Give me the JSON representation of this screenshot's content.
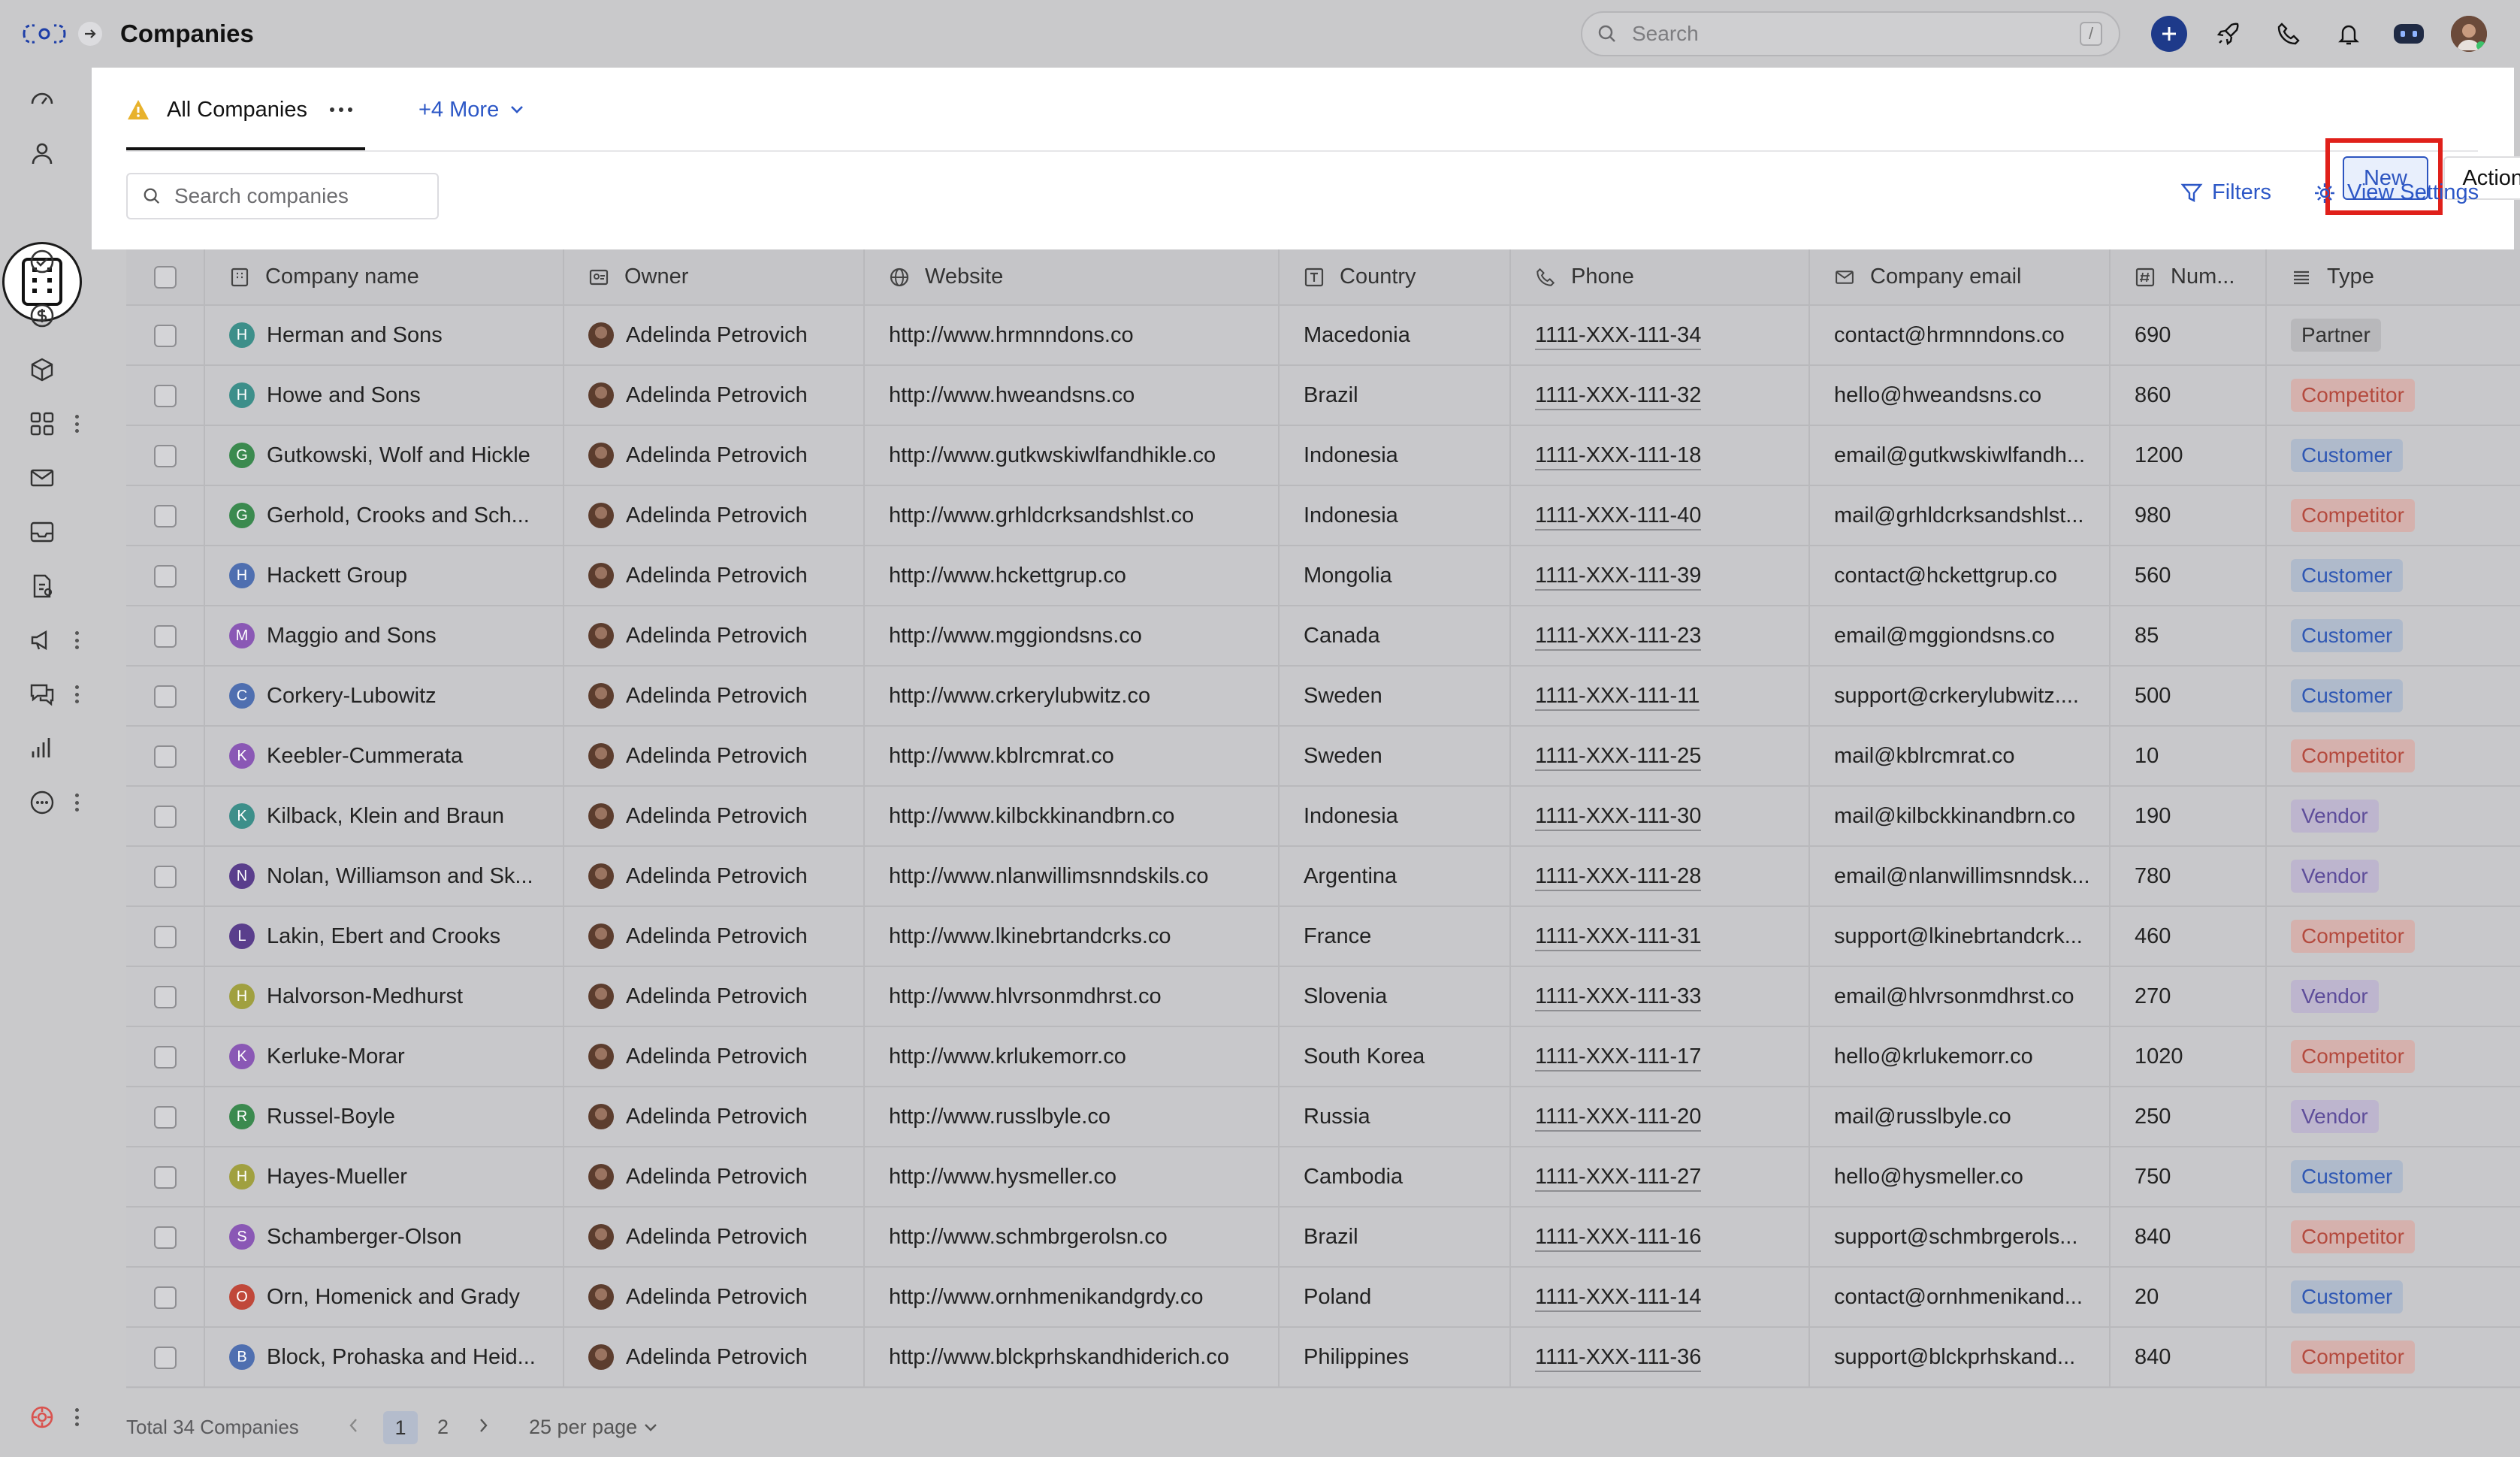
{
  "header": {
    "title": "Companies",
    "search_placeholder": "Search",
    "search_shortcut": "/"
  },
  "view": {
    "tab_label": "All Companies",
    "more_tabs": "+4 More",
    "new_button": "New",
    "actions_button": "Actions",
    "search_placeholder": "Search companies",
    "filters_label": "Filters",
    "view_settings_label": "View Settings"
  },
  "columns": [
    "Company name",
    "Owner",
    "Website",
    "Country",
    "Phone",
    "Company email",
    "Num...",
    "Type"
  ],
  "rows": [
    {
      "initial": "H",
      "color": "#3d8f8a",
      "name": "Herman and Sons",
      "owner": "Adelinda Petrovich",
      "website": "http://www.hrmnndons.co",
      "country": "Macedonia",
      "phone": "1111-XXX-111-34",
      "email": "contact@hrmnndons.co",
      "num": "690",
      "type": "Partner"
    },
    {
      "initial": "H",
      "color": "#3d8f8a",
      "name": "Howe and Sons",
      "owner": "Adelinda Petrovich",
      "website": "http://www.hweandsns.co",
      "country": "Brazil",
      "phone": "1111-XXX-111-32",
      "email": "hello@hweandsns.co",
      "num": "860",
      "type": "Competitor"
    },
    {
      "initial": "G",
      "color": "#3b8a4f",
      "name": "Gutkowski, Wolf and Hickle",
      "owner": "Adelinda Petrovich",
      "website": "http://www.gutkwskiwlfandhikle.co",
      "country": "Indonesia",
      "phone": "1111-XXX-111-18",
      "email": "email@gutkwskiwlfandh...",
      "num": "1200",
      "type": "Customer"
    },
    {
      "initial": "G",
      "color": "#3b8a4f",
      "name": "Gerhold, Crooks and Sch...",
      "owner": "Adelinda Petrovich",
      "website": "http://www.grhldcrksandshlst.co",
      "country": "Indonesia",
      "phone": "1111-XXX-111-40",
      "email": "mail@grhldcrksandshlst...",
      "num": "980",
      "type": "Competitor"
    },
    {
      "initial": "H",
      "color": "#4f6fb0",
      "name": "Hackett Group",
      "owner": "Adelinda Petrovich",
      "website": "http://www.hckettgrup.co",
      "country": "Mongolia",
      "phone": "1111-XXX-111-39",
      "email": "contact@hckettgrup.co",
      "num": "560",
      "type": "Customer"
    },
    {
      "initial": "M",
      "color": "#8a58b5",
      "name": "Maggio and Sons",
      "owner": "Adelinda Petrovich",
      "website": "http://www.mggiondsns.co",
      "country": "Canada",
      "phone": "1111-XXX-111-23",
      "email": "email@mggiondsns.co",
      "num": "85",
      "type": "Customer"
    },
    {
      "initial": "C",
      "color": "#4f6fb0",
      "name": "Corkery-Lubowitz",
      "owner": "Adelinda Petrovich",
      "website": "http://www.crkerylubwitz.co",
      "country": "Sweden",
      "phone": "1111-XXX-111-11",
      "email": "support@crkerylubwitz....",
      "num": "500",
      "type": "Customer"
    },
    {
      "initial": "K",
      "color": "#8a58b5",
      "name": "Keebler-Cummerata",
      "owner": "Adelinda Petrovich",
      "website": "http://www.kblrcmrat.co",
      "country": "Sweden",
      "phone": "1111-XXX-111-25",
      "email": "mail@kblrcmrat.co",
      "num": "10",
      "type": "Competitor"
    },
    {
      "initial": "K",
      "color": "#3d8f8a",
      "name": "Kilback, Klein and Braun",
      "owner": "Adelinda Petrovich",
      "website": "http://www.kilbckkinandbrn.co",
      "country": "Indonesia",
      "phone": "1111-XXX-111-30",
      "email": "mail@kilbckkinandbrn.co",
      "num": "190",
      "type": "Vendor"
    },
    {
      "initial": "N",
      "color": "#5a3e8c",
      "name": "Nolan, Williamson and Sk...",
      "owner": "Adelinda Petrovich",
      "website": "http://www.nlanwillimsnndskils.co",
      "country": "Argentina",
      "phone": "1111-XXX-111-28",
      "email": "email@nlanwillimsnndsk...",
      "num": "780",
      "type": "Vendor"
    },
    {
      "initial": "L",
      "color": "#5a3e8c",
      "name": "Lakin, Ebert and Crooks",
      "owner": "Adelinda Petrovich",
      "website": "http://www.lkinebrtandcrks.co",
      "country": "France",
      "phone": "1111-XXX-111-31",
      "email": "support@lkinebrtandcrk...",
      "num": "460",
      "type": "Competitor"
    },
    {
      "initial": "H",
      "color": "#a0a040",
      "name": "Halvorson-Medhurst",
      "owner": "Adelinda Petrovich",
      "website": "http://www.hlvrsonmdhrst.co",
      "country": "Slovenia",
      "phone": "1111-XXX-111-33",
      "email": "email@hlvrsonmdhrst.co",
      "num": "270",
      "type": "Vendor"
    },
    {
      "initial": "K",
      "color": "#8a58b5",
      "name": "Kerluke-Morar",
      "owner": "Adelinda Petrovich",
      "website": "http://www.krlukemorr.co",
      "country": "South Korea",
      "phone": "1111-XXX-111-17",
      "email": "hello@krlukemorr.co",
      "num": "1020",
      "type": "Competitor"
    },
    {
      "initial": "R",
      "color": "#3b8a4f",
      "name": "Russel-Boyle",
      "owner": "Adelinda Petrovich",
      "website": "http://www.russlbyle.co",
      "country": "Russia",
      "phone": "1111-XXX-111-20",
      "email": "mail@russlbyle.co",
      "num": "250",
      "type": "Vendor"
    },
    {
      "initial": "H",
      "color": "#a0a040",
      "name": "Hayes-Mueller",
      "owner": "Adelinda Petrovich",
      "website": "http://www.hysmeller.co",
      "country": "Cambodia",
      "phone": "1111-XXX-111-27",
      "email": "hello@hysmeller.co",
      "num": "750",
      "type": "Customer"
    },
    {
      "initial": "S",
      "color": "#8a58b5",
      "name": "Schamberger-Olson",
      "owner": "Adelinda Petrovich",
      "website": "http://www.schmbrgerolsn.co",
      "country": "Brazil",
      "phone": "1111-XXX-111-16",
      "email": "support@schmbrgerols...",
      "num": "840",
      "type": "Competitor"
    },
    {
      "initial": "O",
      "color": "#c0483a",
      "name": "Orn, Homenick and Grady",
      "owner": "Adelinda Petrovich",
      "website": "http://www.ornhmenikandgrdy.co",
      "country": "Poland",
      "phone": "1111-XXX-111-14",
      "email": "contact@ornhmenikand...",
      "num": "20",
      "type": "Customer"
    },
    {
      "initial": "B",
      "color": "#4f6fb0",
      "name": "Block, Prohaska and Heid...",
      "owner": "Adelinda Petrovich",
      "website": "http://www.blckprhskandhiderich.co",
      "country": "Philippines",
      "phone": "1111-XXX-111-36",
      "email": "support@blckprhskand...",
      "num": "840",
      "type": "Competitor"
    }
  ],
  "footer": {
    "total": "Total 34 Companies",
    "page_1": "1",
    "page_2": "2",
    "per_page": "25 per page"
  },
  "icons": {
    "sidebar": [
      "dashboard-icon",
      "contacts-icon",
      "companies-icon",
      "tasks-icon",
      "deals-icon",
      "products-icon",
      "apps-icon",
      "mail-icon",
      "inbox-icon",
      "documents-icon",
      "campaigns-icon",
      "chat-icon",
      "reports-icon",
      "more-icon",
      "settings-icon"
    ],
    "topbar": [
      "search-icon",
      "plus-icon",
      "rocket-icon",
      "phone-icon",
      "bell-icon",
      "bot-icon",
      "user-avatar"
    ]
  },
  "colors": {
    "accent": "#2c57c6",
    "highlight": "#e0201a",
    "competitor": "#b44a3e",
    "customer": "#2f57b3",
    "vendor": "#5e4d9a"
  }
}
